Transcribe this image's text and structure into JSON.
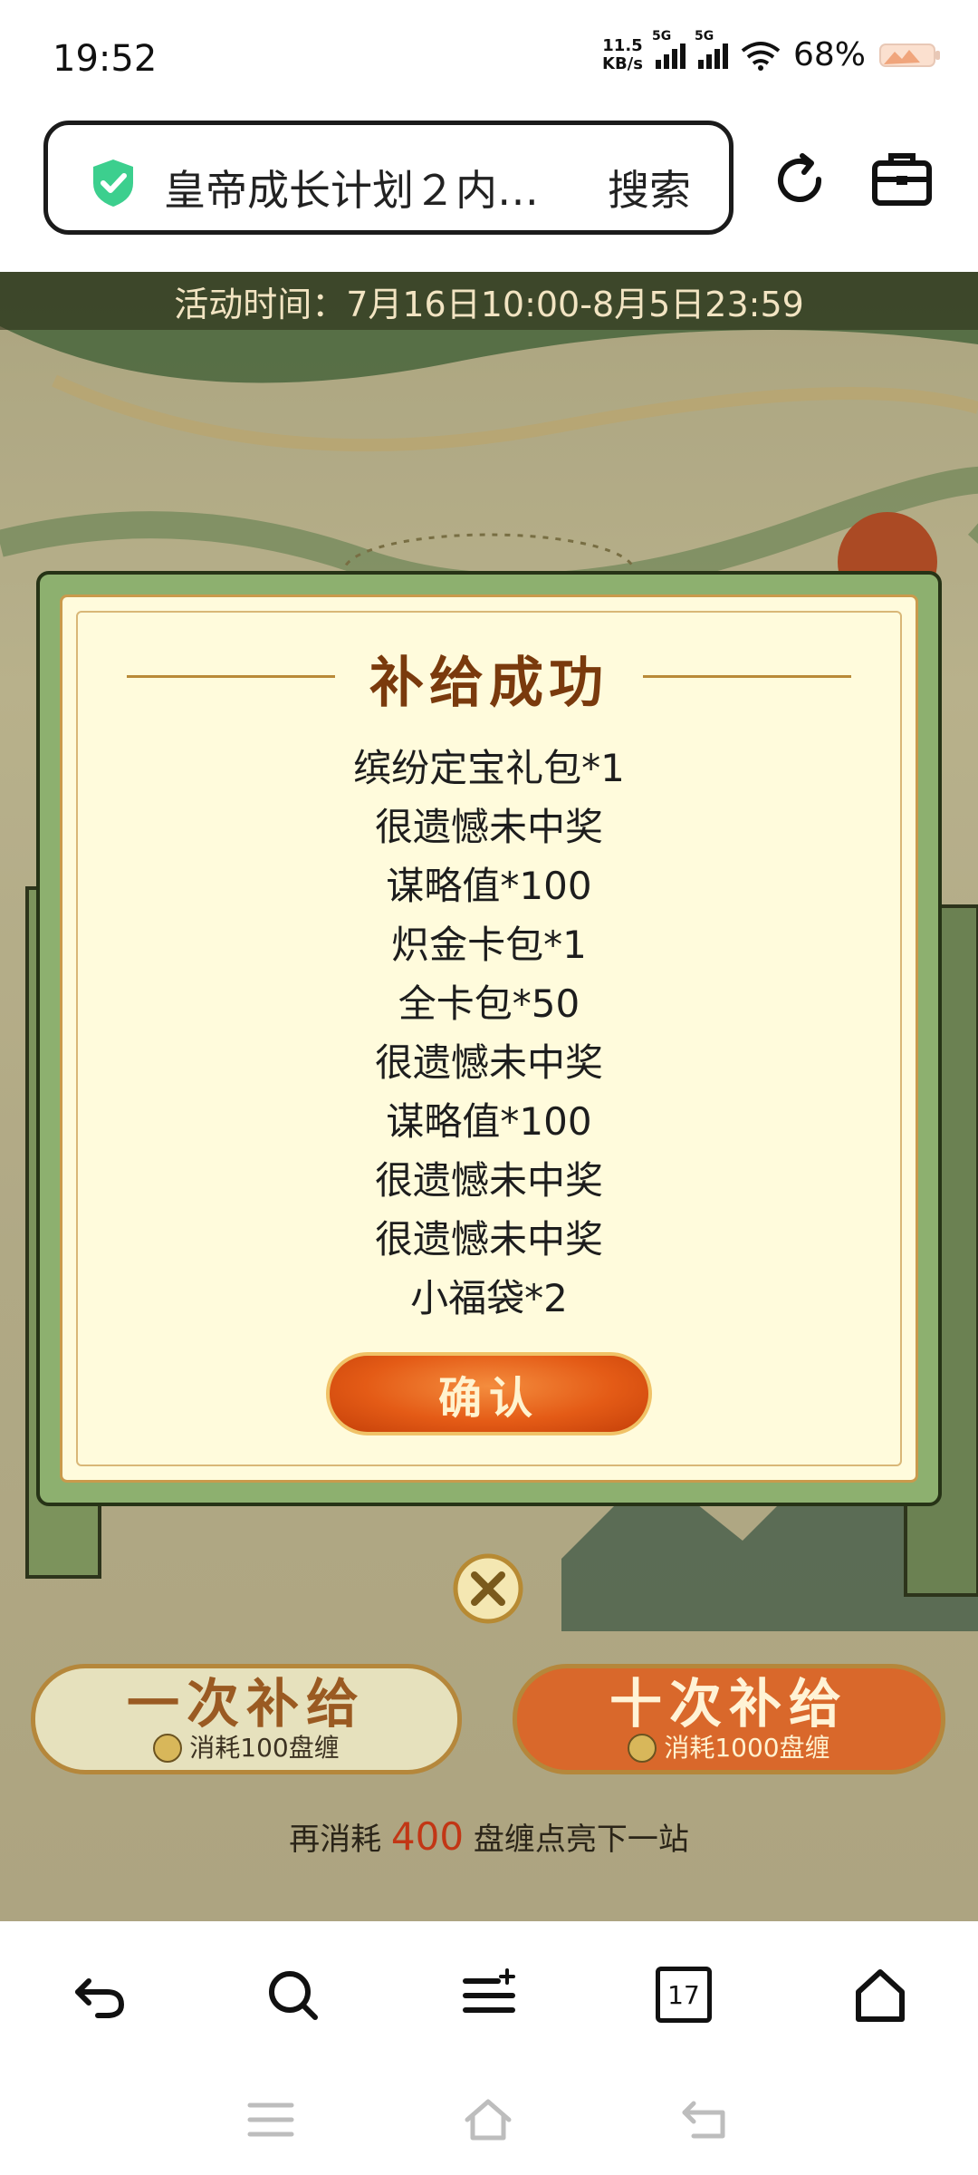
{
  "status": {
    "time": "19:52",
    "net_speed_top": "11.5",
    "net_speed_unit": "KB/s",
    "sig1_label": "5G",
    "sig2_label": "5G",
    "battery": "68%"
  },
  "browser": {
    "url_text": "皇帝成长计划２内…",
    "search_label": "搜索",
    "bottom_tab_count": "17"
  },
  "page": {
    "event_time": "活动时间：7月16日10:00-8月5日23:59",
    "modal": {
      "title": "补给成功",
      "results": [
        "缤纷定宝礼包*1",
        "很遗憾未中奖",
        "谋略值*100",
        "炽金卡包*1",
        "全卡包*50",
        "很遗憾未中奖",
        "谋略值*100",
        "很遗憾未中奖",
        "很遗憾未中奖",
        "小福袋*2"
      ],
      "confirm": "确认"
    },
    "single_supply": {
      "title": "一次补给",
      "cost": "消耗100盘缠"
    },
    "ten_supply": {
      "title": "十次补给",
      "cost": "消耗1000盘缠"
    },
    "progress_prefix": "再消耗",
    "progress_amount": "400",
    "progress_suffix": "盘缠点亮下一站"
  },
  "colors": {
    "accent_orange": "#e45b16",
    "modal_bg": "#fffbdc",
    "frame_green": "#8db06f",
    "title_brown": "#7a3a0d",
    "shield_green": "#3ccf8e"
  }
}
